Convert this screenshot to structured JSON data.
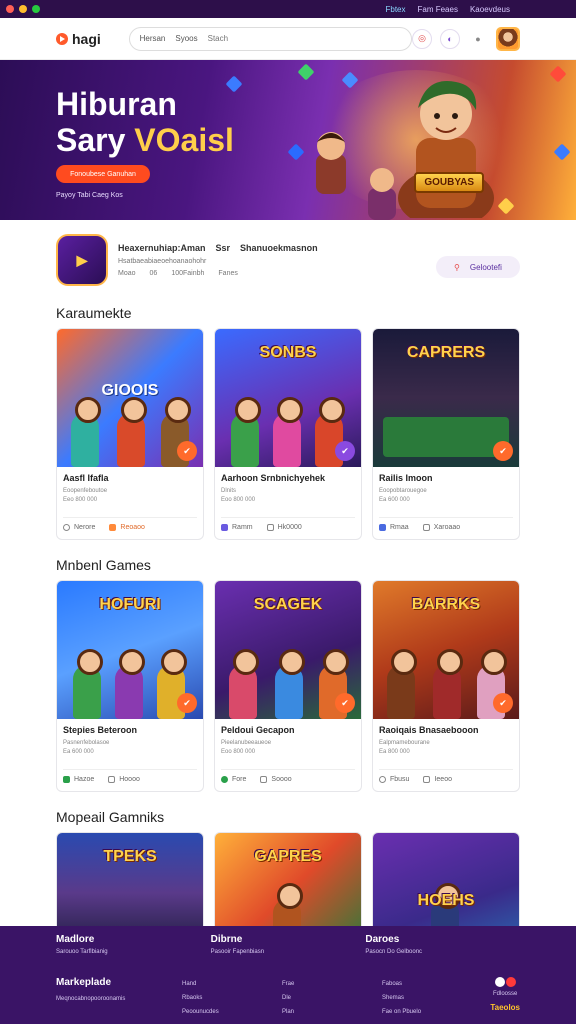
{
  "os_bar": {
    "links": [
      "Fbtex",
      "Fam Feaes",
      "Kaoevdeus"
    ]
  },
  "header": {
    "logo_text": "hagi",
    "search": {
      "tabs": [
        "Hersan",
        "Syoos"
      ],
      "placeholder": "Stach"
    },
    "icons": [
      "notification-icon",
      "chat-icon",
      "user-avatar"
    ]
  },
  "hero": {
    "title_line1": "Hiburan",
    "title_line2a": "Sary ",
    "title_line2b": "VOaisl",
    "cta": "Fonoubese Ganuhan",
    "subtitle": "Payoy Tabi Caeg Kos",
    "badge": "GOUBYAS",
    "colors": {
      "accent": "#ff4b1f",
      "title_accent": "#ffcf4a"
    }
  },
  "app": {
    "name": "Heaxernuhiap:Aman",
    "tag": "Ssr",
    "publisher": "Shanuoekmasnon",
    "line1": "Hsatbaeabiaeoehoanaohohr",
    "line2": [
      "Moao",
      "06",
      "100Fainbh",
      "Fanes"
    ],
    "button": "Gelootefi"
  },
  "sections": [
    {
      "title": "Karaumekte",
      "cards": [
        {
          "thumb_title": "GIOOIS",
          "title": "Aasfl Ifafla",
          "meta1": "Eoopenfeboutoe",
          "meta2": "Eeo 800 000",
          "foot": [
            "Nerore",
            "Reoaoo"
          ]
        },
        {
          "thumb_title": "SONBS",
          "title": "Aarhoon Srnbnichyehek",
          "meta1": "Dlnits",
          "meta2": "Eoo 800 000",
          "foot": [
            "Ramm",
            "Hk0000"
          ]
        },
        {
          "thumb_title": "CAPRERS",
          "title": "Railis Imoon",
          "meta1": "Eoopobtarouegoe",
          "meta2": "Ea 600 000",
          "foot": [
            "Rmaa",
            "Xaroaao"
          ]
        }
      ]
    },
    {
      "title": "Mnbenl Games",
      "cards": [
        {
          "thumb_title": "HOFURI",
          "title": "Stepies Beteroon",
          "meta1": "Pasnenfebolasoe",
          "meta2": "Ea 600 000",
          "foot": [
            "Hazoe",
            "Hoooo"
          ]
        },
        {
          "thumb_title": "SCAGEK",
          "title": "Peldoui Gecapon",
          "meta1": "Pieelanubeeaueoe",
          "meta2": "Eoo 800 000",
          "foot": [
            "Fore",
            "Soooo"
          ]
        },
        {
          "thumb_title": "BARRKS",
          "title": "Raoiqais Bnasaebooon",
          "meta1": "Ealpmamebourane",
          "meta2": "Ea 800 000",
          "foot": [
            "Fbusu",
            "Ieeoo"
          ]
        }
      ]
    },
    {
      "title": "Mopeail Gamniks",
      "cards": [
        {
          "thumb_title": "TPEKS"
        },
        {
          "thumb_title": "GAPRES"
        },
        {
          "thumb_title": "HOEHS"
        }
      ]
    }
  ],
  "footer": {
    "cols": [
      {
        "title": "Madlore",
        "text": "Sarouoo Tarflbianig"
      },
      {
        "title": "Dibrne",
        "text": "Pasooir Fapenbiasn"
      },
      {
        "title": "Daroes",
        "text": "Pasocn Do Gelboonc"
      }
    ],
    "brand": {
      "title": "Markeplade",
      "text": "Meqnocabnopooroonamis"
    },
    "list1": [
      "Hand",
      "Rbaoks",
      "Peoounucdes"
    ],
    "list2": [
      "Frae",
      "Dle",
      "Plan"
    ],
    "list3": [
      "Faboas",
      "Shemas",
      "Fae on Pbuelo"
    ],
    "end": {
      "label": "Fdloosse",
      "logo": "Taeolos"
    }
  }
}
